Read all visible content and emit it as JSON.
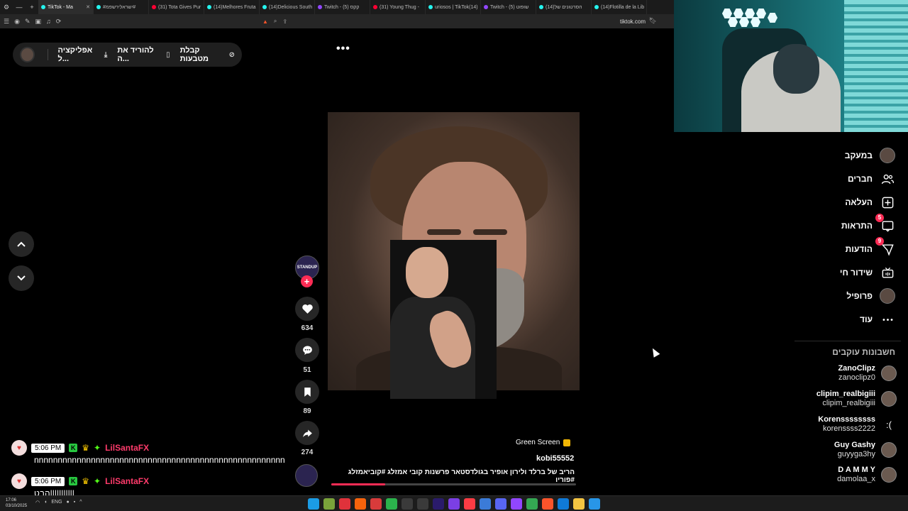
{
  "browser": {
    "tabs": [
      {
        "label": "TikTok - Ma",
        "icon": "tiktok",
        "active": true
      },
      {
        "label": "#ישראלירשפמ# ",
        "icon": "tiktok"
      },
      {
        "label": "(31) Tota Gives Pur",
        "icon": "youtube"
      },
      {
        "label": "(14)Melhores Fruta",
        "icon": "tiktok"
      },
      {
        "label": "(14)Delicious South",
        "icon": "tiktok"
      },
      {
        "label": "Twitch - קקס (5)",
        "icon": "twitch"
      },
      {
        "label": "(31) Young Thug -",
        "icon": "youtube"
      },
      {
        "label": "uriosos | TikTok(14)",
        "icon": "tiktok"
      },
      {
        "label": "Twitch - שופוט (5)",
        "icon": "twitch"
      },
      {
        "label": "(14)הסרטונים של",
        "icon": "tiktok"
      },
      {
        "label": "(14)Flotilla de la Lib",
        "icon": "tiktok"
      }
    ],
    "url": "tiktok.com"
  },
  "topbar": {
    "coins": "קבלת מטבעות",
    "download": "להוריד את ה...",
    "app": "אפליקציה ל..."
  },
  "actions": {
    "creator_badge": "STANDUP",
    "likes": "634",
    "comments": "51",
    "saves": "89",
    "shares": "274"
  },
  "caption": {
    "effect": "Green Screen",
    "username": "kobi55552",
    "text": "הריב של ברלד ולירון אופיר בגולדסטאר פרשנות קובי אמזלג #קוביאמזלג #פוריו",
    "progress": 0.22
  },
  "chat": [
    {
      "time": "5:06 PM",
      "name": "LilSantaFX",
      "message": "nnnnnnnnnnnnnnnnnnnnnnnnnnnnnnnnnnnnnnnnnnnnnnnnnnnnn"
    },
    {
      "time": "5:06 PM",
      "name": "LilSantaFX",
      "message": "הבט|||||||||||"
    }
  ],
  "sidebar": {
    "items": [
      {
        "label": "במעקב",
        "icon": "following-avatar-icon"
      },
      {
        "label": "חברים",
        "icon": "friends-icon"
      },
      {
        "label": "העלאה",
        "icon": "upload-icon"
      },
      {
        "label": "התראות",
        "icon": "inbox-icon",
        "badge": "5"
      },
      {
        "label": "הודעות",
        "icon": "messages-icon",
        "badge": "9"
      },
      {
        "label": "שידור חי",
        "icon": "live-icon"
      },
      {
        "label": "פרופיל",
        "icon": "profile-avatar-icon"
      },
      {
        "label": "עוד",
        "icon": "more-icon"
      }
    ],
    "following_title": "חשבונות עוקבים",
    "accounts": [
      {
        "name": "ZanoClipz",
        "handle": "zanoclipz0"
      },
      {
        "name": "clipim_realbigiii",
        "handle": "clipim_realbigiii"
      },
      {
        "name": "Korenssssssss",
        "handle": "korenssss2222",
        "symbol": ":("
      },
      {
        "name": "Guy Gashy",
        "handle": "guyyga3hy"
      },
      {
        "name": "D A M M Y",
        "handle": "damolaa_x"
      }
    ]
  },
  "taskbar": {
    "time": "17:06",
    "date": "03/10/2025",
    "lang": "ENG"
  },
  "colors": {
    "accent": "#fe2c55",
    "background": "#000000"
  }
}
